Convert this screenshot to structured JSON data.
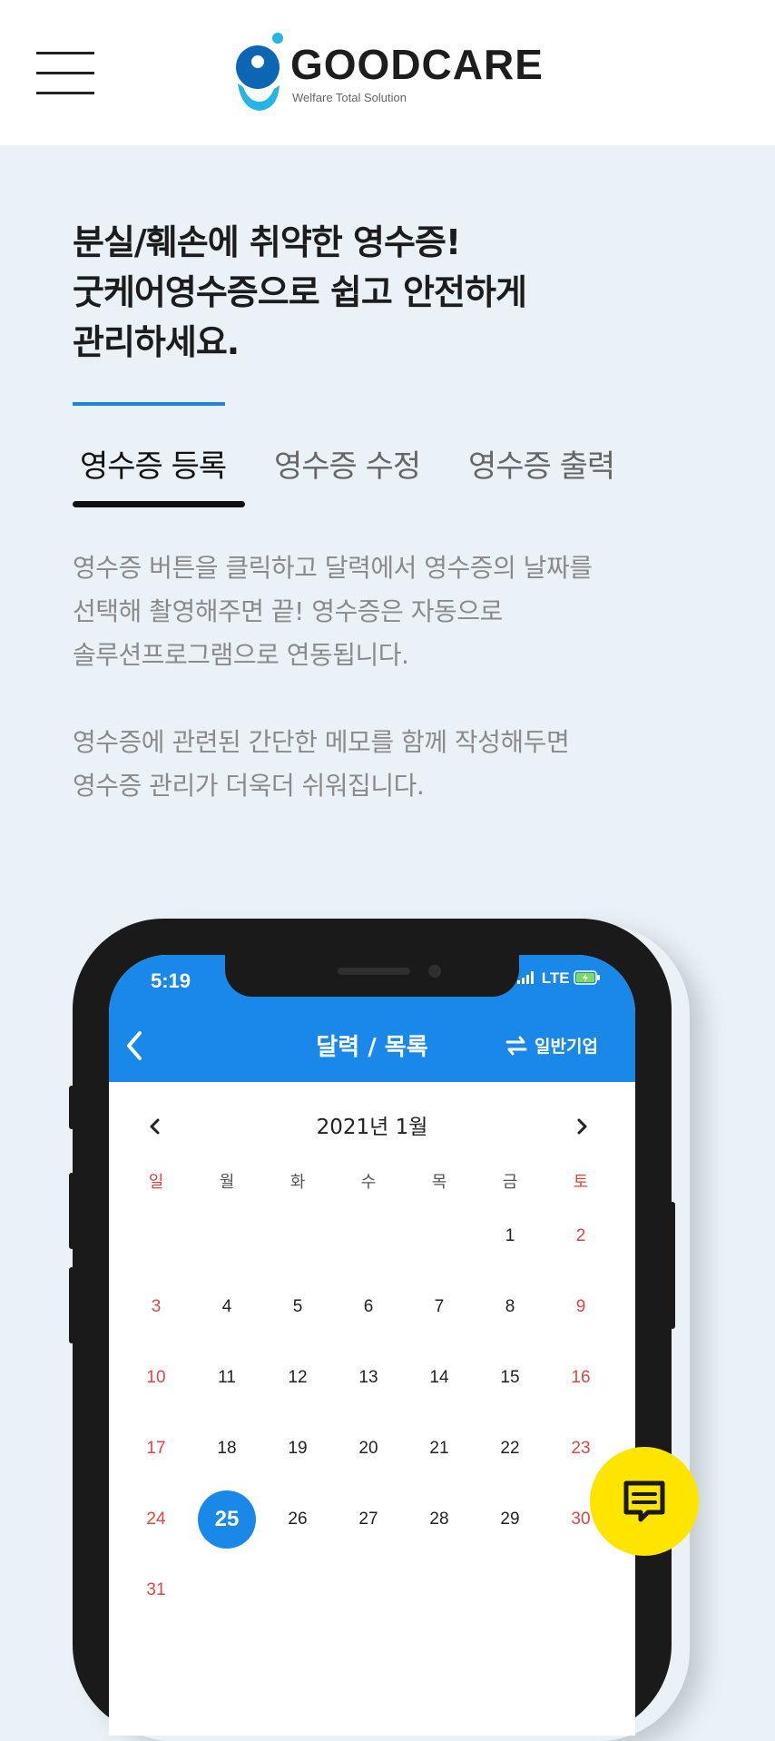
{
  "header": {
    "menu_icon": "hamburger-menu-icon",
    "logo": {
      "name": "GOODCARE",
      "tagline": "Welfare Total Solution",
      "colors": [
        "#0d66b3",
        "#25b5e4"
      ]
    }
  },
  "headline": [
    "분실/훼손에 취약한 영수증!",
    "굿케어영수증으로 쉽고 안전하게",
    "관리하세요."
  ],
  "tabs": [
    {
      "label": "영수증 등록",
      "active": true
    },
    {
      "label": "영수증 수정",
      "active": false
    },
    {
      "label": "영수증 출력",
      "active": false
    }
  ],
  "description": {
    "paragraph1": [
      "영수증 버튼을 클릭하고 달력에서 영수증의 날짜를",
      "선택해 촬영해주면 끝! 영수증은 자동으로",
      "솔루션프로그램으로 연동됩니다."
    ],
    "paragraph2": [
      "영수증에 관련된 간단한 메모를 함께 작성해두면",
      "영수증 관리가 더욱더 쉬워집니다."
    ]
  },
  "phone": {
    "status_time": "5:19",
    "network": "LTE",
    "appbar_title": "달력 / 목록",
    "switch_label": "일반기업",
    "month": "2021년 1월",
    "weekdays": [
      "일",
      "월",
      "화",
      "수",
      "목",
      "금",
      "토"
    ],
    "days": {
      "r0": [
        "1",
        "2"
      ],
      "r1": [
        "3",
        "4",
        "5",
        "6",
        "7",
        "8",
        "9"
      ],
      "r2": [
        "10",
        "11",
        "12",
        "13",
        "14",
        "15",
        "16"
      ],
      "r3": [
        "17",
        "18",
        "19",
        "20",
        "21",
        "22",
        "23"
      ],
      "r4": [
        "24",
        "25",
        "26",
        "27",
        "28",
        "29",
        "30"
      ],
      "r5": [
        "31"
      ]
    },
    "selected_day": "25"
  },
  "chat_button": {
    "icon": "chat-message-icon",
    "color": "#fee500"
  },
  "colors": {
    "accent": "#1a86e0",
    "background": "#eaf2f8",
    "sunday_red": "#e04545"
  }
}
